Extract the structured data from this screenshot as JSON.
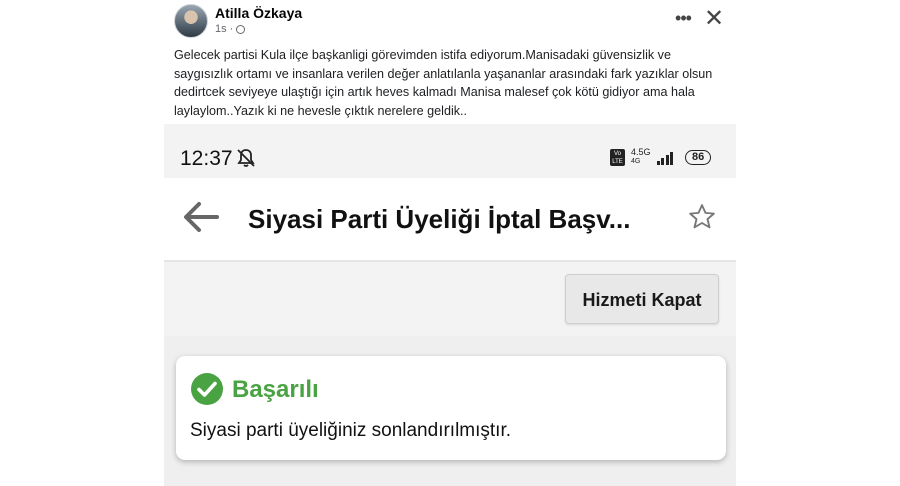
{
  "post": {
    "author": "Atilla Özkaya",
    "time": "1s",
    "text": "Gelecek partisi Kula ilçe başkanligi görevimden istifa ediyorum.Manisadaki güvensizlik ve saygısızlık ortamı ve insanlara verilen değer anlatılanla yaşananlar arasındaki fark yazıklar olsun dedirtcek seviyeye ulaştığı için artık heves kalmadı Manisa malesef çok kötü gidiyor ama hala laylaylom..Yazık ki ne hevesle çıktık nerelere geldik.."
  },
  "screenshot": {
    "status": {
      "time": "12:37",
      "volte": "Vo LTE",
      "network": "4.5G",
      "network_sub": "4G",
      "battery": "86"
    },
    "header": {
      "title": "Siyasi Parti Üyeliği İptal Başv..."
    },
    "close_service_label": "Hizmeti Kapat",
    "alert": {
      "title": "Başarılı",
      "message": "Siyasi parti üyeliğiniz sonlandırılmıştır."
    }
  },
  "icons": [
    "globe-icon",
    "more-options-icon",
    "close-icon",
    "muted-bell-icon",
    "back-arrow-icon",
    "star-icon",
    "success-check-icon"
  ],
  "colors": {
    "success": "#4aa343",
    "text": "#111111",
    "meta": "#65676b"
  }
}
